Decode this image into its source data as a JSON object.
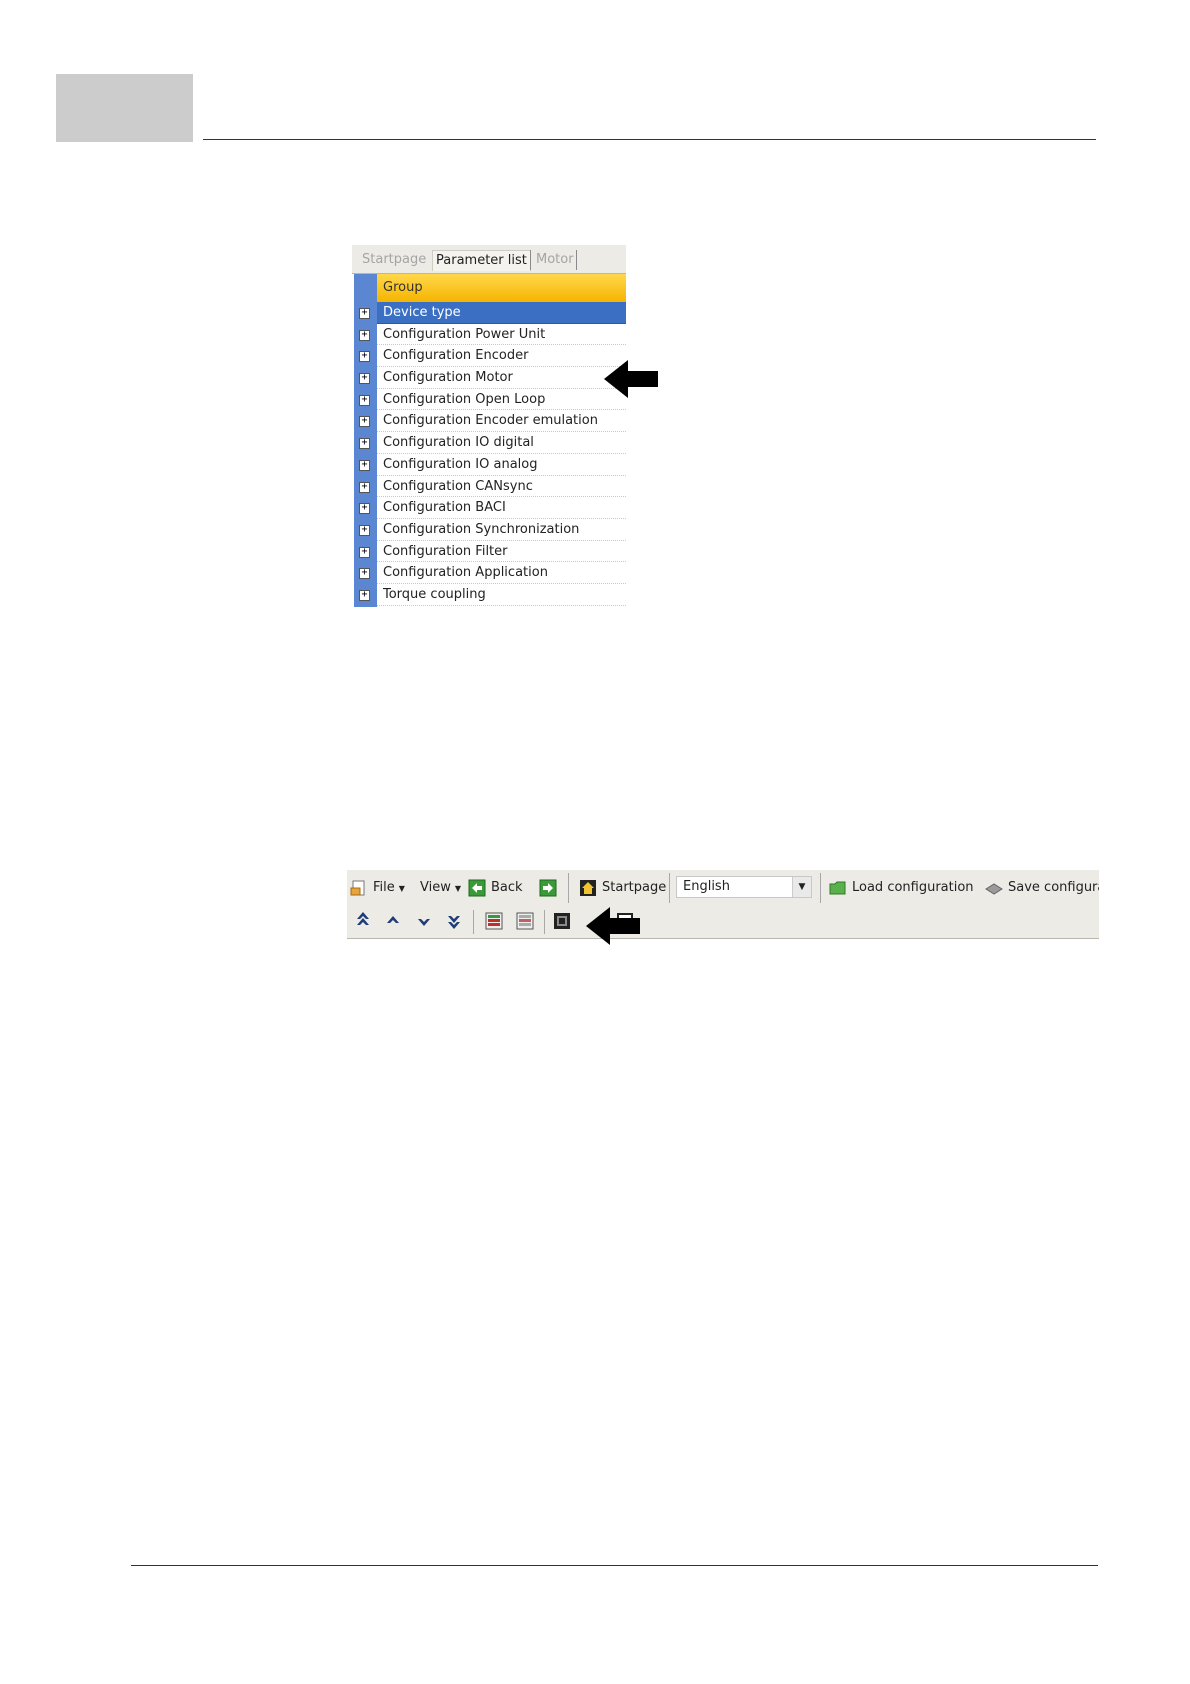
{
  "tabs": {
    "startpage": "Startpage",
    "parameter_list": "Parameter list",
    "motor": "Motor"
  },
  "grid": {
    "header": "Group",
    "rows": [
      "Device type",
      "Configuration Power Unit",
      "Configuration Encoder",
      "Configuration Motor",
      "Configuration Open Loop",
      "Configuration Encoder emulation",
      "Configuration IO digital",
      "Configuration IO analog",
      "Configuration CANsync",
      "Configuration BACI",
      "Configuration Synchronization",
      "Configuration Filter",
      "Configuration Application",
      "Torque coupling"
    ],
    "expander_symbol": "+"
  },
  "toolbar": {
    "file": "File",
    "view": "View",
    "back": "Back",
    "startpage": "Startpage",
    "language": "English",
    "load_configuration": "Load configuration",
    "save_configuration": "Save configura"
  },
  "colors": {
    "selected_row": "#3a6fc4",
    "header_gold": "#f5b400",
    "left_bar": "#5a86d2"
  }
}
